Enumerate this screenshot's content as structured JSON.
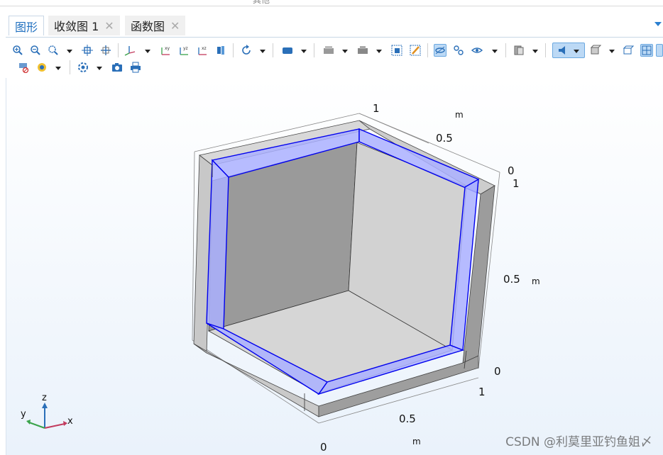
{
  "window_top_label": "其他",
  "tabs": [
    {
      "label": "图形",
      "active": true,
      "closable": false
    },
    {
      "label": "收敛图 1",
      "active": false,
      "closable": true
    },
    {
      "label": "函数图",
      "active": false,
      "closable": true
    }
  ],
  "toolbar": {
    "row1": [
      "zoom-in-icon",
      "zoom-out-icon",
      "zoom-box-icon",
      "zoom-extents-icon",
      "translate-icon",
      "axis-icon",
      "xy-view-icon",
      "yz-view-icon",
      "xz-view-icon",
      "depth-icon",
      "rotate-icon",
      "render-mode-icon",
      "lighting-icon",
      "clip-icon",
      "select-box-icon",
      "clear-select-icon",
      "wireframe-toggle-icon",
      "link-icon",
      "eye-icon",
      "transparency-icon",
      "speaker-icon",
      "cube-view-icon",
      "wire-box-icon",
      "grid-icon"
    ],
    "row2": [
      "hide-icon",
      "scene-icon",
      "light-icon",
      "camera-icon",
      "print-icon"
    ]
  },
  "plot": {
    "x_ticks": [
      "0",
      "0.5",
      "1"
    ],
    "x_unit": "m",
    "y_ticks": [
      "0",
      "0.5",
      "1"
    ],
    "y_unit": "m",
    "z_ticks": [
      "0",
      "0.5",
      "1"
    ],
    "z_unit": "m",
    "triad": {
      "x": "x",
      "y": "y",
      "z": "z"
    },
    "colors": {
      "selection": "#0000ff",
      "highlight_fill": "#aab0ff",
      "geometry": "#c8c8c8"
    }
  },
  "watermark": "CSDN @利莫里亚钓鱼姐〆"
}
